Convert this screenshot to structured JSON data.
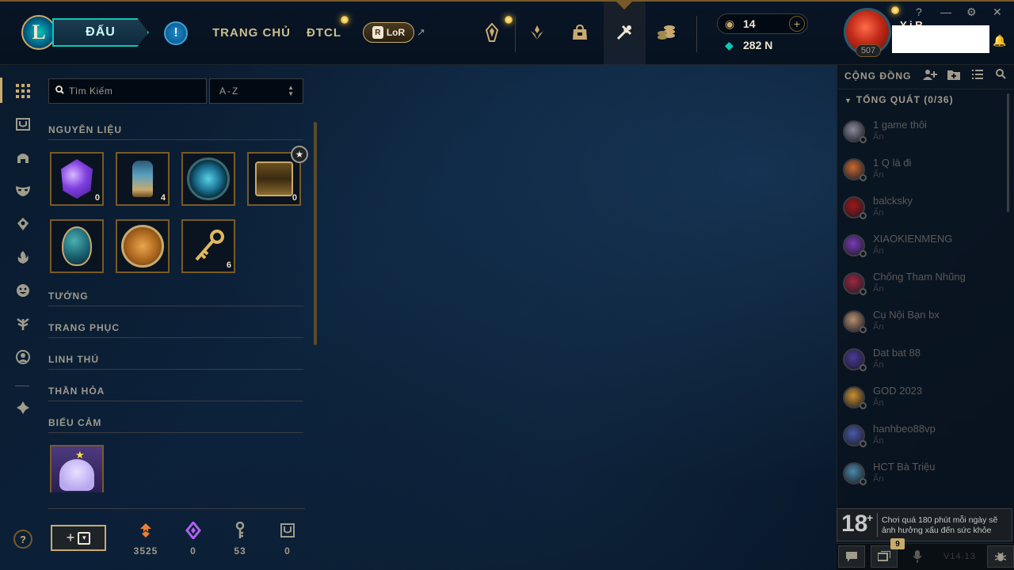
{
  "header": {
    "play_label": "ĐẤU",
    "nav_home": "TRANG CHỦ",
    "nav_tft": "ĐTCL",
    "lor_label": "LoR",
    "lor_badge": "R",
    "ext_arrow": "↗",
    "rp_value": "14",
    "be_value": "282 N",
    "level": "507",
    "name_partial": "Y    i R",
    "logo": "L",
    "icons": [
      "crystal-icon",
      "challenge-icon",
      "store-icon",
      "loot-icon",
      "currency-icon"
    ],
    "window_controls": [
      "?",
      "—",
      "⚙",
      "✕"
    ]
  },
  "sidebar": {
    "icons": [
      "grid-icon",
      "chest-icon",
      "helmet-icon",
      "mask-icon",
      "ward-icon",
      "flame-icon",
      "emote-icon",
      "tree-icon",
      "profile-icon",
      "map-icon"
    ],
    "help": "?"
  },
  "inventory": {
    "search_placeholder": "Tìm Kiếm",
    "sort_value": "A-Z",
    "sections": [
      "NGUYÊN LIỆU",
      "TƯỚNG",
      "TRANG PHỤC",
      "LINH THÚ",
      "THẦN HỎA",
      "BIỂU CẢM"
    ],
    "materials": [
      {
        "name": "gemstone",
        "count": "0"
      },
      {
        "name": "lantern",
        "count": "4"
      },
      {
        "name": "mastery-token",
        "count": ""
      },
      {
        "name": "masterwork-chest",
        "count": "0"
      },
      {
        "name": "egg",
        "count": ""
      },
      {
        "name": "orb",
        "count": ""
      },
      {
        "name": "key",
        "count": "6"
      }
    ],
    "resources": [
      {
        "name": "orange-essence-icon",
        "value": "3525"
      },
      {
        "name": "mythic-essence-icon",
        "value": "0"
      },
      {
        "name": "key-fragment-icon",
        "value": "53"
      },
      {
        "name": "chest-count-icon",
        "value": "0"
      }
    ],
    "craft_plus": "+"
  },
  "social": {
    "title": "CỘNG ĐỒNG",
    "group": "TỔNG QUÁT (0/36)",
    "friends": [
      {
        "name": "1 game thôi",
        "status": "Ẩn",
        "color": "#8a8a9a"
      },
      {
        "name": "1 Q là đi",
        "status": "Ẩn",
        "color": "#c86a30"
      },
      {
        "name": "balcksky",
        "status": "Ẩn",
        "color": "#a01818"
      },
      {
        "name": "XIAOKIENMENG",
        "status": "Ẩn",
        "color": "#7a3ab8"
      },
      {
        "name": "Chống Tham Nhũng",
        "status": "Ẩn",
        "color": "#a02840"
      },
      {
        "name": "Cụ Nội Bạn bx",
        "status": "Ẩn",
        "color": "#b89070"
      },
      {
        "name": "Dat bat 88",
        "status": "Ẩn",
        "color": "#4a3a98"
      },
      {
        "name": "GOD 2023",
        "status": "Ẩn",
        "color": "#c89030"
      },
      {
        "name": "hanhbeo88vp",
        "status": "Ẩn",
        "color": "#4a5aa8"
      },
      {
        "name": "HCT Bà Triệu",
        "status": "Ẩn",
        "color": "#4a8aa8"
      }
    ],
    "age_mark": "18",
    "age_plus": "+",
    "age_warning": "Chơi quá 180 phút mỗi ngày sẽ ảnh hưởng xấu đến sức khỏe",
    "badge_count": "9",
    "version": "V14.13"
  }
}
